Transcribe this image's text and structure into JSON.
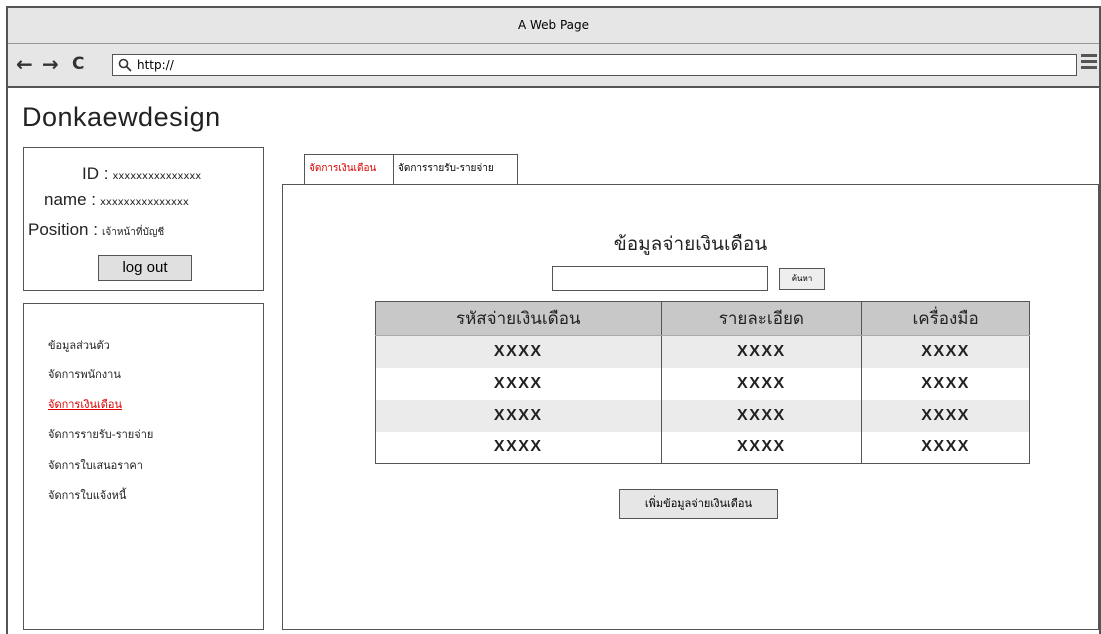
{
  "window": {
    "title": "A Web Page"
  },
  "browser": {
    "back_icon": "←",
    "forward_icon": "→",
    "reload_icon": "C",
    "address": "http://"
  },
  "brand": "Donkaewdesign",
  "user": {
    "id_label": "ID :",
    "id_value": "xxxxxxxxxxxxxxx",
    "name_label": "name :",
    "name_value": "xxxxxxxxxxxxxxx",
    "position_label": "Position :",
    "position_value": "เจ้าหน้าที่บัญชี",
    "logout_label": "log out"
  },
  "sidebar": {
    "items": [
      {
        "label": "ข้อมูลส่วนตัว",
        "active": false
      },
      {
        "label": "จัดการพนักงาน",
        "active": false
      },
      {
        "label": "จัดการเงินเดือน",
        "active": true
      },
      {
        "label": "จัดการรายรับ-รายจ่าย",
        "active": false
      },
      {
        "label": "จัดการใบเสนอราคา",
        "active": false
      },
      {
        "label": "จัดการใบแจ้งหนี้",
        "active": false
      }
    ]
  },
  "tabs": [
    {
      "label": "จัดการเงินเดือน",
      "active": true
    },
    {
      "label": "จัดการรายรับ-รายจ่าย",
      "active": false
    }
  ],
  "main": {
    "title": "ข้อมูลจ่ายเงินเดือน",
    "search_value": "",
    "search_button": "ค้นหา",
    "table": {
      "headers": [
        "รหัสจ่ายเงินเดือน",
        "รายละเอียด",
        "เครื่องมือ"
      ],
      "rows": [
        [
          "XXXX",
          "XXXX",
          "XXXX"
        ],
        [
          "XXXX",
          "XXXX",
          "XXXX"
        ],
        [
          "XXXX",
          "XXXX",
          "XXXX"
        ],
        [
          "XXXX",
          "XXXX",
          "XXXX"
        ]
      ]
    },
    "add_button": "เพิ่มข้อมูลจ่ายเงินเดือน"
  },
  "colors": {
    "active": "#dd0000",
    "header_bg": "#c8c8c8",
    "row_alt": "#ebebeb"
  }
}
